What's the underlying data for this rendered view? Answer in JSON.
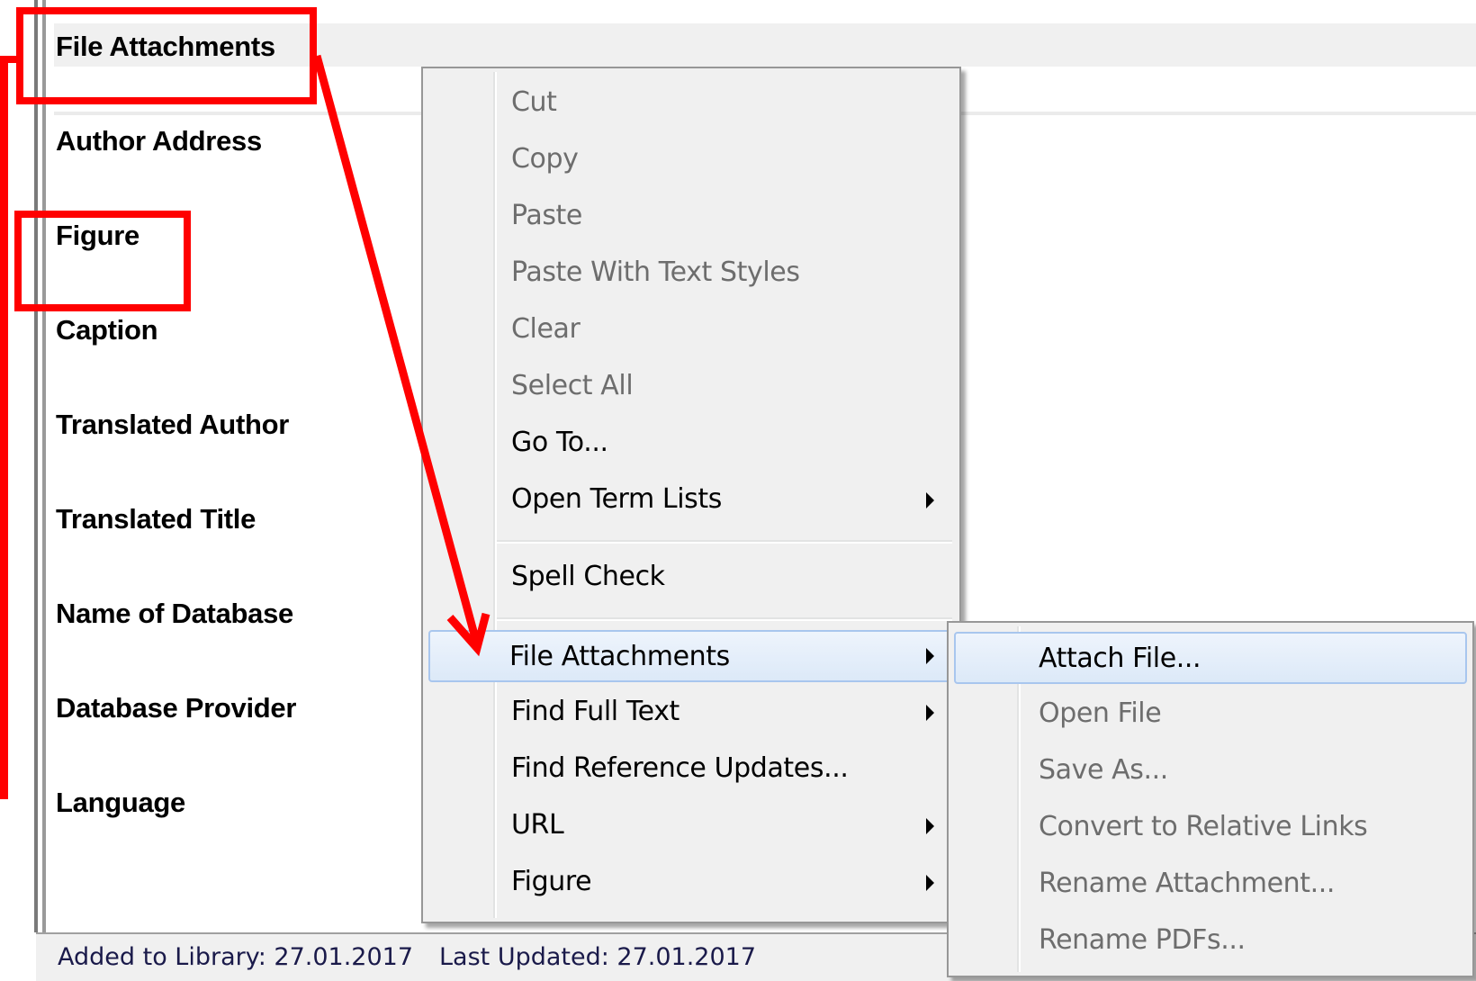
{
  "reference_panel": {
    "header_field": "File Attachments",
    "fields": [
      "Author Address",
      "Figure",
      "Caption",
      "Translated Author",
      "Translated Title",
      "Name of Database",
      "Database Provider",
      "Language"
    ]
  },
  "status_bar": {
    "added": "Added to Library: 27.01.2017",
    "updated": "Last Updated: 27.01.2017"
  },
  "context_menu": {
    "items": [
      {
        "label": "Cut",
        "enabled": false
      },
      {
        "label": "Copy",
        "enabled": false
      },
      {
        "label": "Paste",
        "enabled": false
      },
      {
        "label": "Paste With Text Styles",
        "enabled": false
      },
      {
        "label": "Clear",
        "enabled": false
      },
      {
        "label": "Select All",
        "enabled": false
      },
      {
        "label": "Go To...",
        "enabled": true
      },
      {
        "label": "Open Term Lists",
        "enabled": true,
        "submenu": true
      },
      {
        "label": "Spell Check",
        "enabled": true
      },
      {
        "label": "File Attachments",
        "enabled": true,
        "submenu": true,
        "highlighted": true
      },
      {
        "label": "Find Full Text",
        "enabled": true,
        "submenu": true
      },
      {
        "label": "Find Reference Updates...",
        "enabled": true
      },
      {
        "label": "URL",
        "enabled": true,
        "submenu": true
      },
      {
        "label": "Figure",
        "enabled": true,
        "submenu": true
      }
    ]
  },
  "submenu": {
    "items": [
      {
        "label": "Attach File...",
        "enabled": true,
        "highlighted": true
      },
      {
        "label": "Open File",
        "enabled": false
      },
      {
        "label": "Save As...",
        "enabled": false
      },
      {
        "label": "Convert to Relative Links",
        "enabled": false
      },
      {
        "label": "Rename Attachment...",
        "enabled": false
      },
      {
        "label": "Rename PDFs...",
        "enabled": false
      }
    ]
  },
  "colors": {
    "annotation": "#ff0000",
    "menu_background": "#f0f0f0",
    "hover_border": "#a8c6ee",
    "disabled_text": "#6d6d6d"
  }
}
